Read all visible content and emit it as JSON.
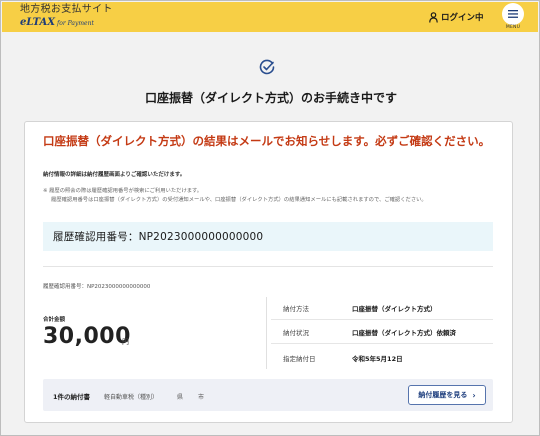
{
  "header": {
    "site_title": "地方税お支払サイト",
    "logo_main": "eLTAX",
    "logo_sub": "for Payment",
    "login_label": "ログイン中",
    "menu_label": "MENU"
  },
  "page_title": "口座振替（ダイレクト方式）のお手続き中です",
  "notice": {
    "title": "口座振替（ダイレクト方式）の結果はメールでお知らせします。必ずご確認ください。",
    "subtitle": "納付情報の詳細は納付履歴画面よりご確認いただけます。",
    "note_line1": "※ 履歴の照会の際は履歴確認用番号が検索にご利用いただけます。",
    "note_line2": "履歴確認用番号は口座振替（ダイレクト方式）の受付通知メールや、口座振替（ダイレクト方式）の結果通知メールにも記載されますので、ご確認ください。"
  },
  "history_box": "履歴確認用番号：NP2023000000000000",
  "history_small": "履歴確認用番号：NP2023000000000000",
  "total": {
    "label": "合計金額",
    "value": "30,000",
    "unit": "円"
  },
  "info_rows": [
    {
      "label": "納付方法",
      "value": "口座振替（ダイレクト方式）"
    },
    {
      "label": "納付状況",
      "value": "口座振替（ダイレクト方式）依頼済"
    },
    {
      "label": "指定納付日",
      "value": "令和5年5月12日"
    }
  ],
  "bottom": {
    "count": "1件の納付書",
    "item": "軽自動車税（種別）",
    "pref": "県",
    "city": "市",
    "button_label": "納付履歴を見る",
    "button_chevron": "›"
  },
  "colors": {
    "header_bg": "#f7cf45",
    "notice_red": "#c43a14",
    "accent_blue": "#1f3f7e"
  }
}
